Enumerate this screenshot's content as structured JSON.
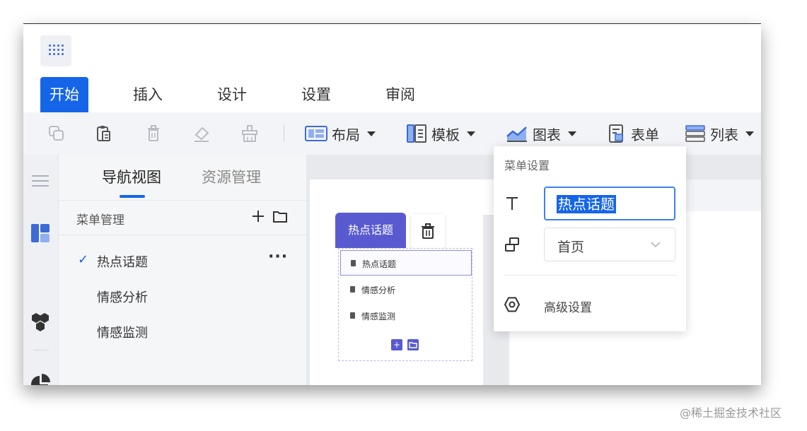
{
  "menu_tabs": [
    {
      "label": "开始",
      "active": true
    },
    {
      "label": "插入"
    },
    {
      "label": "设计"
    },
    {
      "label": "设置"
    },
    {
      "label": "审阅"
    }
  ],
  "toolbar": {
    "icons": [
      "copy-icon",
      "paste-icon",
      "delete-icon",
      "eraser-icon",
      "clear-format-icon"
    ],
    "layout_label": "布局",
    "template_label": "模板",
    "chart_label": "图表",
    "form_label": "表单",
    "list_label": "列表"
  },
  "rail_icons": [
    "hamburger-icon",
    "layout-panel-icon",
    "components-icon",
    "pie-chart-icon"
  ],
  "left_panel": {
    "tabs": [
      {
        "label": "导航视图",
        "active": true
      },
      {
        "label": "资源管理"
      }
    ],
    "section_title": "菜单管理",
    "items": [
      {
        "label": "热点话题",
        "selected": true
      },
      {
        "label": "情感分析"
      },
      {
        "label": "情感监测"
      }
    ]
  },
  "canvas": {
    "selected_tag": "热点话题",
    "menu_items": [
      "热点话题",
      "情感分析",
      "情感监测"
    ]
  },
  "popover": {
    "title": "菜单设置",
    "name_value": "热点话题",
    "page_value": "首页",
    "advanced_label": "高级设置"
  },
  "watermark": "@稀土掘金技术社区",
  "colors": {
    "accent": "#1565e8",
    "tag_purple": "#5a5ad0",
    "toolbar_bg": "#f3f4f7"
  }
}
